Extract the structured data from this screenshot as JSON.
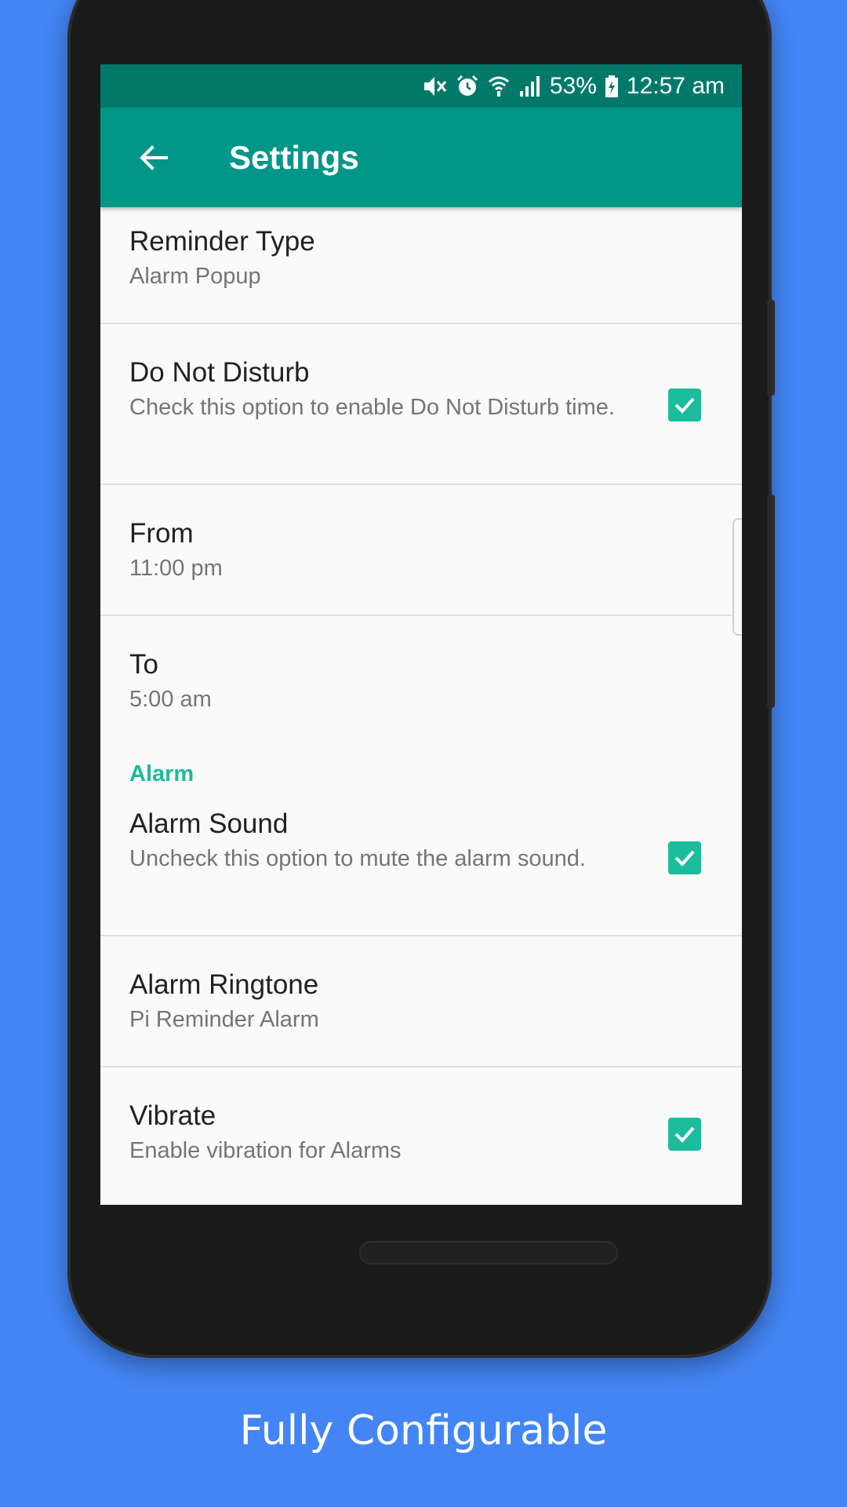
{
  "status_bar": {
    "battery": "53%",
    "time": "12:57 am",
    "icons": [
      "mute-icon",
      "alarm-clock-icon",
      "wifi-icon",
      "signal-icon",
      "battery-charging-icon"
    ]
  },
  "toolbar": {
    "title": "Settings",
    "back_icon": "arrow-back-icon"
  },
  "settings": {
    "reminder_type": {
      "title": "Reminder Type",
      "summary": "Alarm Popup"
    },
    "do_not_disturb": {
      "title": "Do Not Disturb",
      "summary": "Check this option to enable Do Not Disturb time.",
      "checked": true
    },
    "from": {
      "title": "From",
      "summary": "11:00 pm"
    },
    "to": {
      "title": "To",
      "summary": "5:00 am"
    },
    "alarm_category": "Alarm",
    "alarm_sound": {
      "title": "Alarm Sound",
      "summary": "Uncheck this option to mute the alarm sound.",
      "checked": true
    },
    "alarm_ringtone": {
      "title": "Alarm Ringtone",
      "summary": "Pi Reminder Alarm"
    },
    "vibrate": {
      "title": "Vibrate",
      "summary": "Enable vibration for Alarms",
      "checked": true
    }
  },
  "caption": "Fully Configurable",
  "colors": {
    "background": "#4385f4",
    "status_bar": "#00796b",
    "toolbar": "#009688",
    "accent": "#1abc9c"
  }
}
